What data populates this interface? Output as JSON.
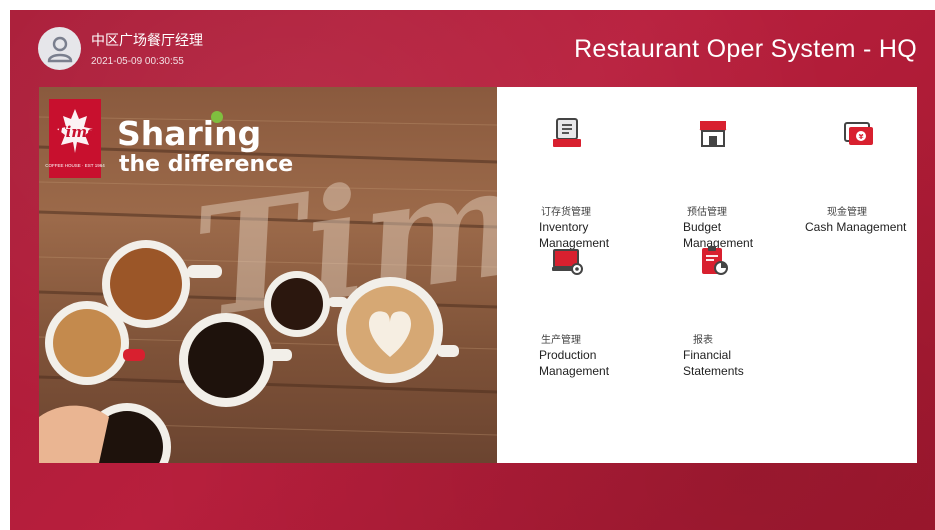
{
  "header": {
    "user_name": "中区广场餐厅经理",
    "timestamp": "2021-05-09 00:30:55",
    "system_title": "Restaurant Oper System - HQ"
  },
  "banner": {
    "brand": "Tims",
    "brand_sub": "COFFEE HOUSE · EST 1964",
    "slogan_line1": "Sharing",
    "slogan_line2": "the difference",
    "watermark": "Tims"
  },
  "menu": {
    "items": [
      {
        "zh": "订存货管理",
        "en_line1": "Inventory",
        "en_line2": "Management",
        "icon": "inventory-icon"
      },
      {
        "zh": "预估管理",
        "en_line1": "Budget",
        "en_line2": "Management",
        "icon": "budget-store-icon"
      },
      {
        "zh": "现金管理",
        "en_line1": "Cash Management",
        "en_line2": "",
        "icon": "cash-icon"
      },
      {
        "zh": "生产管理",
        "en_line1": "Production",
        "en_line2": "Management",
        "icon": "production-icon"
      },
      {
        "zh": "报表",
        "en_line1": "Financial",
        "en_line2": "Statements",
        "icon": "report-icon"
      }
    ]
  },
  "colors": {
    "brand_red": "#b81f3d",
    "icon_red": "#d8202f",
    "panel_bg": "#ffffff"
  }
}
